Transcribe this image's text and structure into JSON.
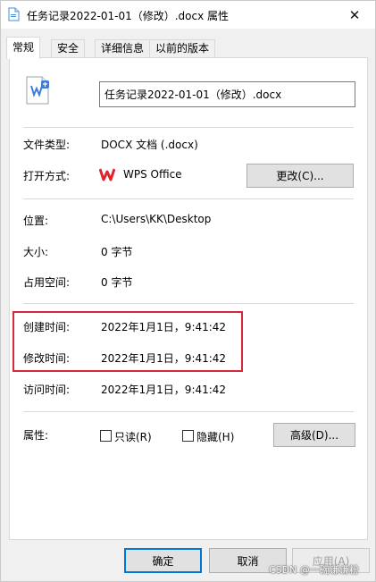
{
  "window": {
    "title": "任务记录2022-01-01（修改）.docx 属性",
    "close_glyph": "✕"
  },
  "tabs": [
    {
      "label": "常规"
    },
    {
      "label": "安全"
    },
    {
      "label": "详细信息"
    },
    {
      "label": "以前的版本"
    }
  ],
  "general": {
    "file_name": "任务记录2022-01-01（修改）.docx",
    "file_type_label": "文件类型:",
    "file_type_value": "DOCX 文档 (.docx)",
    "open_with_label": "打开方式:",
    "open_with_value": "WPS Office",
    "change_button": "更改(C)...",
    "location_label": "位置:",
    "location_value": "C:\\Users\\KK\\Desktop",
    "size_label": "大小:",
    "size_value": "0 字节",
    "disk_size_label": "占用空间:",
    "disk_size_value": "0 字节",
    "created_label": "创建时间:",
    "created_value": "2022年1月1日，9:41:42",
    "modified_label": "修改时间:",
    "modified_value": "2022年1月1日，9:41:42",
    "accessed_label": "访问时间:",
    "accessed_value": "2022年1月1日，9:41:42",
    "attributes_label": "属性:",
    "readonly_label": "只读(R)",
    "hidden_label": "隐藏(H)",
    "advanced_button": "高级(D)..."
  },
  "footer": {
    "ok": "确定",
    "cancel": "取消",
    "apply": "应用(A)"
  },
  "watermark": "CSDN @一碗谦谦粉",
  "colors": {
    "highlight_border": "#d5283b",
    "wps_red": "#e0262c",
    "focus_blue": "#0078d7"
  }
}
